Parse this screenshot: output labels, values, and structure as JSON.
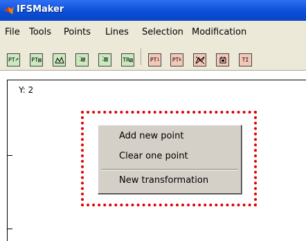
{
  "window": {
    "title": "IFSMaker",
    "icon": "matlab-icon"
  },
  "menubar": {
    "items": [
      "File",
      "Tools",
      "Points",
      "Lines",
      "Selection",
      "Modification"
    ]
  },
  "toolbar": {
    "buttons": [
      {
        "icon": "point-arrow-icon",
        "label": "PT",
        "color": "#cbe9bf"
      },
      {
        "icon": "point-list-icon",
        "label": "PT",
        "color": "#cbe9bf"
      },
      {
        "icon": "polygon-icon",
        "label": "",
        "color": "#cbe9bf"
      },
      {
        "icon": "point-grid-icon",
        "label": "",
        "color": "#cbe9bf"
      },
      {
        "icon": "point-table-icon",
        "label": "",
        "color": "#cbe9bf"
      },
      {
        "icon": "transform-list-icon",
        "label": "TR",
        "color": "#cbe9bf"
      },
      {
        "icon": "point-one-icon",
        "label": "PT",
        "color": "#f3c8b8"
      },
      {
        "icon": "point-k-icon",
        "label": "PT",
        "color": "#f3c8b8"
      },
      {
        "icon": "crossed-shape-icon",
        "label": "",
        "color": "#f3c8b8"
      },
      {
        "icon": "cube-icon",
        "label": "",
        "color": "#f3c8b8"
      },
      {
        "icon": "transform-icon",
        "label": "TI",
        "color": "#f3c8b8"
      }
    ]
  },
  "plot": {
    "y_readout": "Y: 2"
  },
  "context_menu": {
    "items": [
      "Add new point",
      "Clear one point",
      "New transformation"
    ]
  },
  "colors": {
    "titlebar": "#0a4fd8",
    "highlight": "#e00000",
    "menu_bg": "#d4d0c8"
  }
}
